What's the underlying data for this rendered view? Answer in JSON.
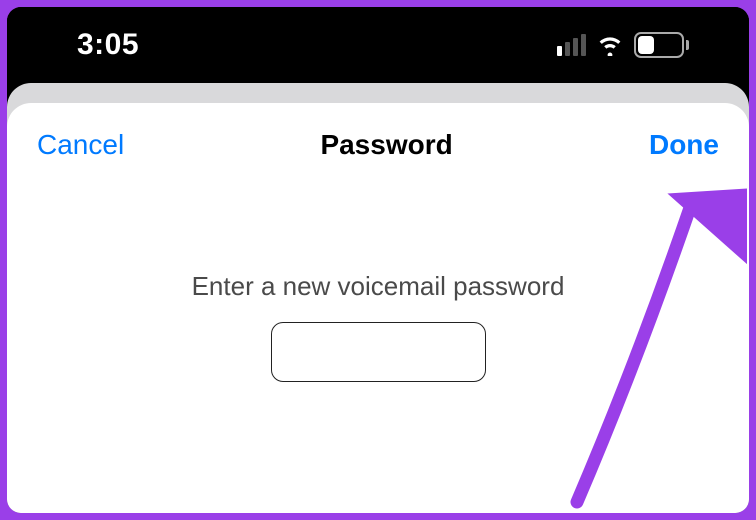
{
  "status_bar": {
    "time": "3:05",
    "battery_percent": "34"
  },
  "modal": {
    "cancel_label": "Cancel",
    "title": "Password",
    "done_label": "Done",
    "prompt": "Enter a new voicemail password",
    "password_value": ""
  },
  "annotation": {
    "arrow_color": "#9a3fe8"
  }
}
